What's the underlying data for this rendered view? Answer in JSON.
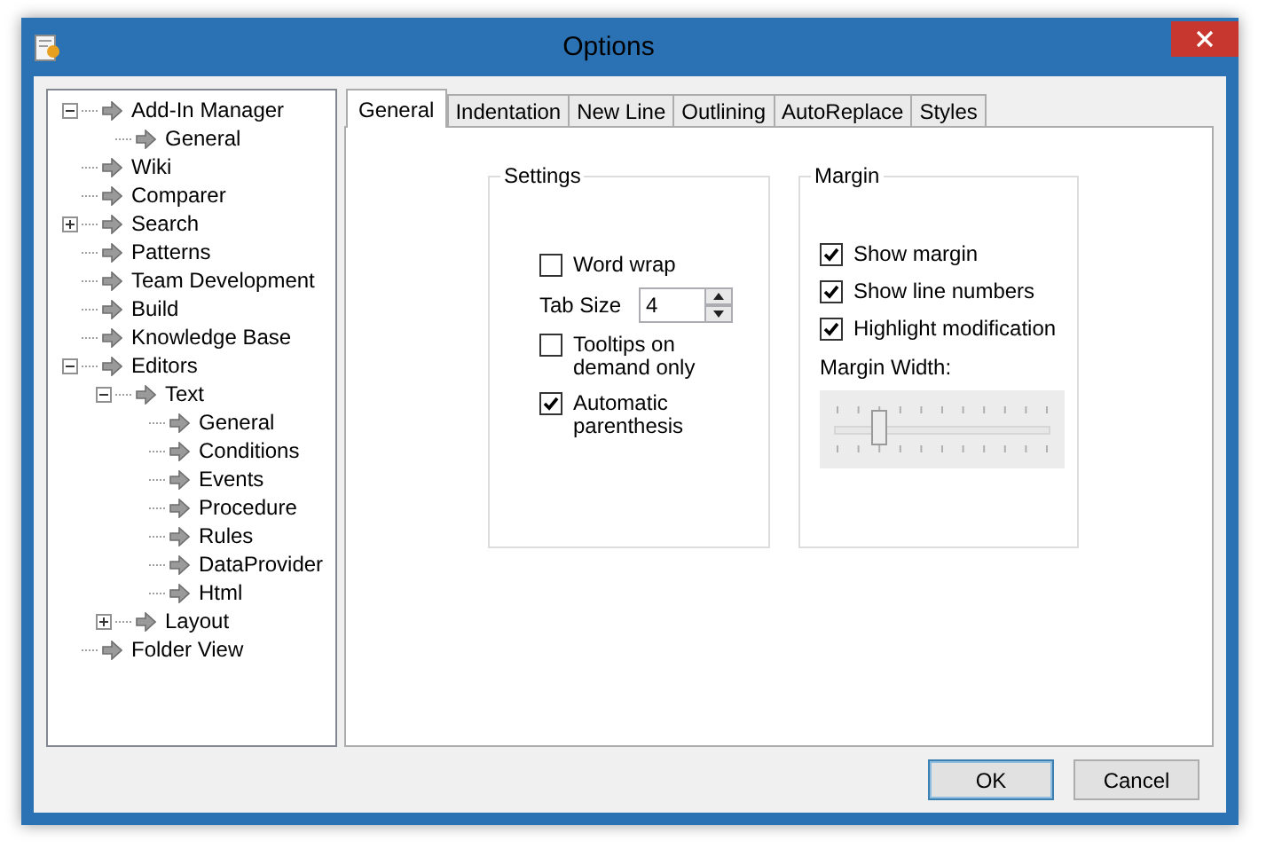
{
  "window": {
    "title": "Options"
  },
  "tree": [
    {
      "label": "Add-In Manager",
      "expanded": true,
      "children": [
        {
          "label": "General"
        }
      ]
    },
    {
      "label": "Wiki"
    },
    {
      "label": "Comparer"
    },
    {
      "label": "Search",
      "expanded": false
    },
    {
      "label": "Patterns"
    },
    {
      "label": "Team Development"
    },
    {
      "label": "Build"
    },
    {
      "label": "Knowledge Base"
    },
    {
      "label": "Editors",
      "expanded": true,
      "children": [
        {
          "label": "Text",
          "expanded": true,
          "children": [
            {
              "label": "General"
            },
            {
              "label": "Conditions"
            },
            {
              "label": "Events"
            },
            {
              "label": "Procedure"
            },
            {
              "label": "Rules"
            },
            {
              "label": "DataProvider"
            },
            {
              "label": "Html"
            }
          ]
        },
        {
          "label": "Layout",
          "expanded": false
        }
      ]
    },
    {
      "label": "Folder View"
    }
  ],
  "tabs": [
    {
      "label": "General",
      "selected": true
    },
    {
      "label": "Indentation",
      "selected": false
    },
    {
      "label": "New Line",
      "selected": false
    },
    {
      "label": "Outlining",
      "selected": false
    },
    {
      "label": "AutoReplace",
      "selected": false
    },
    {
      "label": "Styles",
      "selected": false
    }
  ],
  "settings": {
    "title": "Settings",
    "items": [
      {
        "kind": "checkbox",
        "label": "Word wrap",
        "checked": false
      },
      {
        "kind": "spinner",
        "label": "Tab Size",
        "value": "4"
      },
      {
        "kind": "checkbox",
        "label": "Tooltips on demand only",
        "checked": false
      },
      {
        "kind": "checkbox",
        "label": "Automatic parenthesis",
        "checked": true
      }
    ]
  },
  "margin": {
    "title": "Margin",
    "items": [
      {
        "kind": "checkbox",
        "label": "Show margin",
        "checked": true
      },
      {
        "kind": "checkbox",
        "label": "Show line numbers",
        "checked": true
      },
      {
        "kind": "checkbox",
        "label": "Highlight modification",
        "checked": true
      }
    ],
    "slider": {
      "label": "Margin Width:",
      "level": 0.2
    }
  },
  "buttons": [
    {
      "label": "OK",
      "default": true
    },
    {
      "label": "Cancel",
      "default": false
    }
  ]
}
